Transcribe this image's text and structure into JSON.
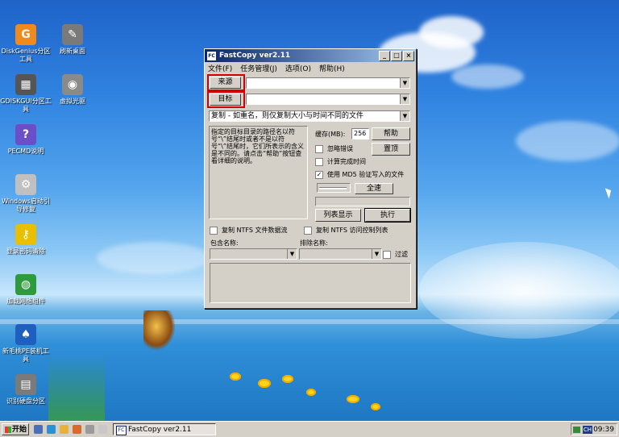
{
  "desktop_icons": [
    {
      "name": "diskgenius-icon",
      "label": "DiskGenius分区工具",
      "color": "#f08a1c",
      "glyph": "G"
    },
    {
      "name": "clear-desktop-icon",
      "label": "刷新桌面",
      "color": "#7a7a7a",
      "glyph": "✎"
    },
    {
      "name": "gdiskgui-icon",
      "label": "GDISKGUI分区工具",
      "color": "#555555",
      "glyph": "▦"
    },
    {
      "name": "virtual-drive-icon",
      "label": "虚拟光驱",
      "color": "#8a8a8a",
      "glyph": "◉"
    },
    {
      "name": "pecmd-help-icon",
      "label": "PECMD说明",
      "color": "#6a4fc8",
      "glyph": "?"
    },
    {
      "name": "windows-boot-repair-icon",
      "label": "Windows启动引导修复",
      "color": "#c0c0c0",
      "glyph": "⚙"
    },
    {
      "name": "login-password-clear-icon",
      "label": "登录密码清除",
      "color": "#e8c000",
      "glyph": "⚷"
    },
    {
      "name": "network-component-icon",
      "label": "加载网络组件",
      "color": "#2e9a3e",
      "glyph": "◍"
    },
    {
      "name": "xinmaotao-pe-icon",
      "label": "新毛桃PE装机工具",
      "color": "#1f5fbf",
      "glyph": "♠"
    },
    {
      "name": "partition-detect-icon",
      "label": "识别硬盘分区",
      "color": "#7a7a7a",
      "glyph": "▤"
    }
  ],
  "window": {
    "title": "FastCopy ver2.11",
    "app_icon": "FC",
    "controls": [
      "_",
      "□",
      "×"
    ],
    "menu": [
      "文件(F)",
      "任务管理(J)",
      "选项(O)",
      "帮助(H)"
    ],
    "source_label": "来源",
    "dest_label": "目标",
    "source_value": "",
    "dest_value": "",
    "mode_value": "复制 - 如重名，则仅复制大小与时间不同的文件",
    "description": "指定的目标目录的路径名以符号“\\”结尾时或者不是以符号“\\”结尾时，它们所表示的含义是不同的。请点击“帮助”按钮查看详细的说明。",
    "buffer_label": "缓存(MB):",
    "buffer_value": "256",
    "help_button": "帮助",
    "top_button": "置顶",
    "ignore_errors": "忽略错误",
    "estimate_time": "计算完成时间",
    "verify_md5": "使用 MD5 验证写入的文件",
    "verify_md5_checked": "✓",
    "speed_button": "全速",
    "list_button": "列表显示",
    "execute_button": "执行",
    "copy_ntfs_streams": "复制 NTFS 文件数据流",
    "copy_ntfs_acl": "复制 NTFS 访问控制列表",
    "include_label": "包含名称:",
    "exclude_label": "排除名称:",
    "filter_label": "过滤"
  },
  "taskbar": {
    "start_label": "开始",
    "task_title": "FastCopy ver2.11",
    "task_icon": "FC",
    "ime": "CH",
    "clock": "09:39"
  }
}
